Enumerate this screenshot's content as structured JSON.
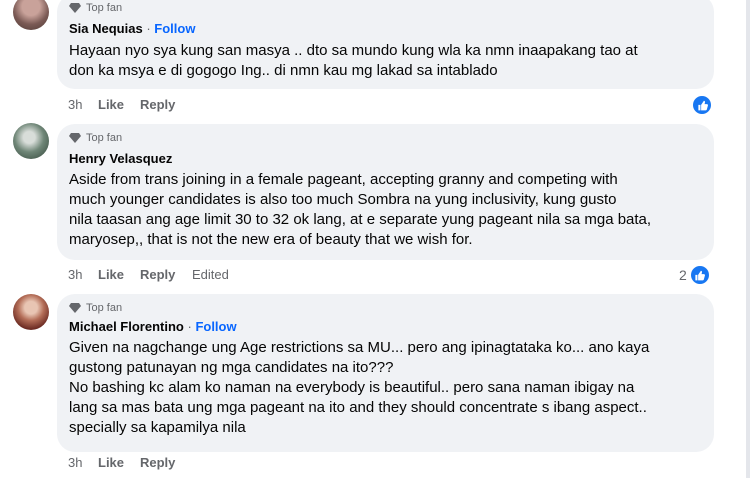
{
  "comments": [
    {
      "badge": "Top fan",
      "author": "Sia Nequias",
      "follow_label": "Follow",
      "lines": [
        "Hayaan nyo sya kung san masya .. dto sa mundo kung wla ka nmn inaapakang tao at",
        "don ka msya e di gogogo Ing.. di nmn kau mg lakad sa intablado"
      ],
      "time": "3h",
      "like_label": "Like",
      "reply_label": "Reply",
      "reaction_count": ""
    },
    {
      "badge": "Top fan",
      "author": "Henry Velasquez",
      "follow_label": "",
      "lines": [
        "Aside from trans joining in a female pageant, accepting granny and competing with",
        "much younger candidates is also too much Sombra na yung inclusivity, kung gusto",
        "nila taasan ang age limit 30 to 32 ok lang, at e separate yung pageant nila sa mga bata,",
        "maryosep,, that is not the new era of beauty that we wish for."
      ],
      "time": "3h",
      "like_label": "Like",
      "reply_label": "Reply",
      "edited_label": "Edited",
      "reaction_count": "2"
    },
    {
      "badge": "Top fan",
      "author": "Michael Florentino",
      "follow_label": "Follow",
      "lines": [
        "Given na nagchange ung Age restrictions sa MU... pero ang ipinagtataka ko... ano kaya",
        "gustong patunayan ng mga candidates na ito???",
        "No bashing kc alam ko naman na everybody is beautiful.. pero sana naman ibigay na",
        "lang sa mas bata ung mga pageant na ito and they should concentrate s ibang aspect..",
        "specially sa kapamilya nila"
      ],
      "time": "3h",
      "like_label": "Like",
      "reply_label": "Reply"
    }
  ],
  "separator": "·",
  "colors": {
    "link": "#0866ff",
    "like": "#1877f2",
    "bubble": "#f0f2f5",
    "meta": "#65676b"
  },
  "icons": [
    "diamond-icon",
    "like-reaction-icon"
  ]
}
